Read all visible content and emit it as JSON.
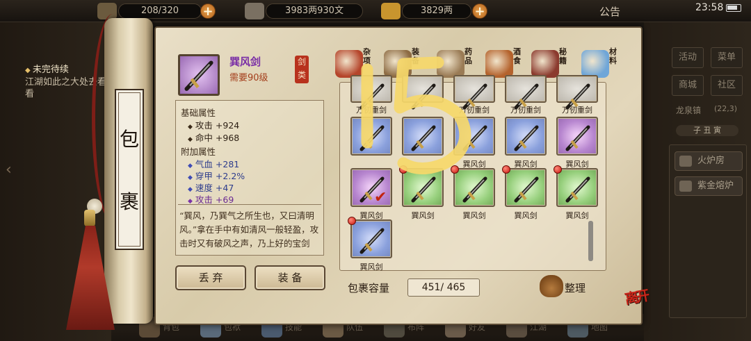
{
  "status_bar": {
    "bag_count": "208/320",
    "money": "3983两930文",
    "gold": "3829两",
    "notice": "公告",
    "time": "23:58"
  },
  "quest": {
    "title": "未完待续",
    "description": "江湖如此之大处去看看"
  },
  "scroll": {
    "chars": [
      "包",
      "裹"
    ]
  },
  "item": {
    "name": "巽风剑",
    "level_req": "需要90级",
    "category_tag": "剑类",
    "base_title": "基础属性",
    "base_stats": [
      {
        "label": "攻击",
        "value": "+924"
      },
      {
        "label": "命中",
        "value": "+968"
      }
    ],
    "extra_title": "附加属性",
    "extra_stats": [
      {
        "label": "气血",
        "value": "+281"
      },
      {
        "label": "穿甲",
        "value": "+2.2%"
      },
      {
        "label": "速度",
        "value": "+47"
      },
      {
        "label": "攻击",
        "value": "+69"
      }
    ],
    "description": "“巽风，乃巽气之所生也，又曰清明风。”拿在手中有如清风一般轻盈，攻击时又有破风之声，乃上好的宝剑"
  },
  "buttons": {
    "discard": "丢 弃",
    "equip": "装 备"
  },
  "tabs": [
    {
      "label": "杂项",
      "color": "#b5452b"
    },
    {
      "label": "装备",
      "color": "#8d6b43"
    },
    {
      "label": "药品",
      "color": "#9a7b55"
    },
    {
      "label": "酒食",
      "color": "#b4622c"
    },
    {
      "label": "秘籍",
      "color": "#8b3a2e"
    },
    {
      "label": "材料",
      "color": "#6fa6d8"
    }
  ],
  "grid": {
    "rows": [
      [
        {
          "name": "万仞重剑",
          "quality": "grey"
        },
        {
          "name": "",
          "quality": "grey"
        },
        {
          "name": "万仞重剑",
          "quality": "grey"
        },
        {
          "name": "万仞重剑",
          "quality": "grey"
        },
        {
          "name": "万仞重剑",
          "quality": "grey"
        }
      ],
      [
        {
          "name": "",
          "quality": "blue"
        },
        {
          "name": "",
          "quality": "blue"
        },
        {
          "name": "巽风剑",
          "quality": "blue"
        },
        {
          "name": "巽风剑",
          "quality": "blue"
        },
        {
          "name": "巽风剑",
          "quality": "purple"
        }
      ],
      [
        {
          "name": "巽风剑",
          "quality": "purple",
          "selected": true
        },
        {
          "name": "巽风剑",
          "quality": "green",
          "dot": true
        },
        {
          "name": "巽风剑",
          "quality": "green",
          "dot": true
        },
        {
          "name": "巽风剑",
          "quality": "green",
          "dot": true
        },
        {
          "name": "巽风剑",
          "quality": "green",
          "dot": true
        }
      ],
      [
        {
          "name": "巽风剑",
          "quality": "blue",
          "dot": true
        }
      ]
    ]
  },
  "capacity": {
    "label": "包裹容量",
    "value": "451/ 465"
  },
  "sort_label": "整理",
  "leave_label": "离开",
  "right_panel": {
    "buttons": [
      "活动",
      "菜单",
      "商城",
      "社区"
    ],
    "location": "龙泉镇",
    "coord": "(22,3)",
    "time_chips": "子 丑 寅",
    "facilities": [
      "火炉房",
      "紫金熔炉"
    ]
  },
  "bottom_bar": [
    "背包",
    "包袱",
    "技能",
    "队伍",
    "布阵",
    "好友",
    "江湖",
    "地图"
  ],
  "overlay_text": "15"
}
